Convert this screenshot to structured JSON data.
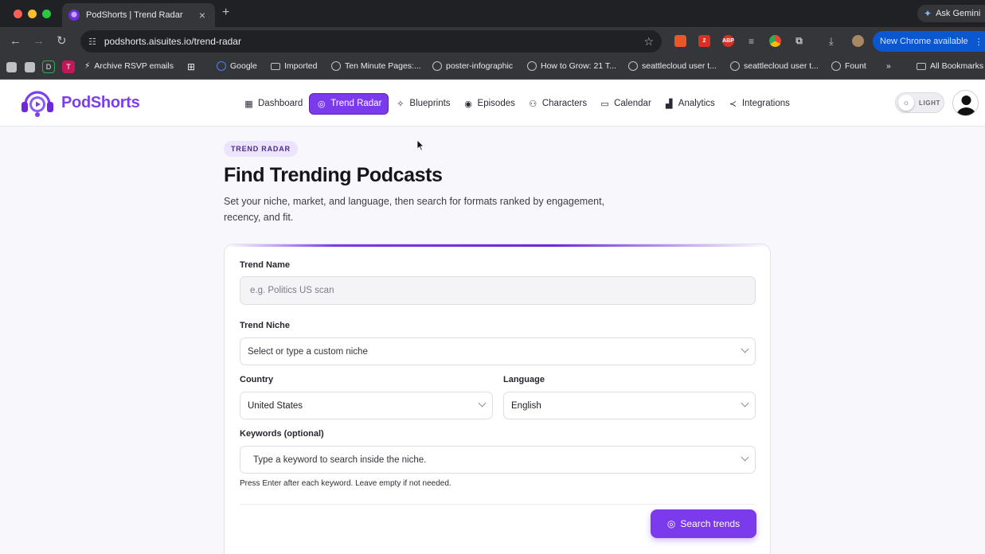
{
  "browser": {
    "tab_title": "PodShorts | Trend Radar",
    "new_tab": "+",
    "close": "×",
    "gemini_label": "Ask Gemini",
    "url": "podshorts.aisuites.io/trend-radar",
    "update_label": "New Chrome available",
    "extensions": [
      {
        "name": "ext-fox-icon",
        "text": "",
        "color": "#e8562a"
      },
      {
        "name": "ext-badge-icon",
        "text": "2",
        "color": "#d93025"
      },
      {
        "name": "ext-abp-icon",
        "text": "ABP",
        "color": "#d93025"
      },
      {
        "name": "ext-menu-icon",
        "text": "≡",
        "color": "#5f6368"
      },
      {
        "name": "ext-chrome-icon",
        "text": "",
        "color": "#4285f4"
      },
      {
        "name": "ext-puzzle-icon",
        "text": "⧉",
        "color": "#5f6368"
      }
    ],
    "bookmarks": {
      "badge_d": "D",
      "badge_t": "T",
      "items": [
        {
          "label": "Archive RSVP emails",
          "icon": "bolt"
        },
        {
          "label": "Google",
          "icon": "globe"
        },
        {
          "label": "Imported",
          "icon": "folder"
        },
        {
          "label": "Ten Minute Pages:...",
          "icon": "globe"
        },
        {
          "label": "poster-infographic",
          "icon": "globe"
        },
        {
          "label": "How to Grow: 21 T...",
          "icon": "globe"
        },
        {
          "label": "seattlecloud user t...",
          "icon": "globe"
        },
        {
          "label": "seattlecloud user t...",
          "icon": "globe"
        },
        {
          "label": "Fount",
          "icon": "globe"
        }
      ],
      "more": "»",
      "all_bookmarks": "All Bookmarks"
    }
  },
  "app": {
    "brand": "PodShorts",
    "brand_color": "#7a3ff0",
    "accent_color": "#7c3aed",
    "nav": [
      {
        "label": "Dashboard",
        "icon": "grid",
        "active": false
      },
      {
        "label": "Trend Radar",
        "icon": "radar",
        "active": true
      },
      {
        "label": "Blueprints",
        "icon": "sparkle",
        "active": false
      },
      {
        "label": "Episodes",
        "icon": "podcast",
        "active": false
      },
      {
        "label": "Characters",
        "icon": "users",
        "active": false
      },
      {
        "label": "Calendar",
        "icon": "calendar",
        "active": false
      },
      {
        "label": "Analytics",
        "icon": "chart",
        "active": false
      },
      {
        "label": "Integrations",
        "icon": "share",
        "active": false
      }
    ],
    "theme_label": "LIGHT"
  },
  "page": {
    "tag": "TREND RADAR",
    "title": "Find Trending Podcasts",
    "subtitle": "Set your niche, market, and language, then search for formats ranked by engagement, recency, and fit."
  },
  "form": {
    "trend_name": {
      "label": "Trend Name",
      "placeholder": "e.g. Politics US scan",
      "value": ""
    },
    "trend_niche": {
      "label": "Trend Niche",
      "placeholder": "Select or type a custom niche"
    },
    "country": {
      "label": "Country",
      "value": "United States"
    },
    "language": {
      "label": "Language",
      "value": "English"
    },
    "keywords": {
      "label": "Keywords (optional)",
      "placeholder": "Type a keyword to search inside the niche."
    },
    "hint": "Press Enter after each keyword. Leave empty if not needed.",
    "submit_label": "Search trends"
  }
}
